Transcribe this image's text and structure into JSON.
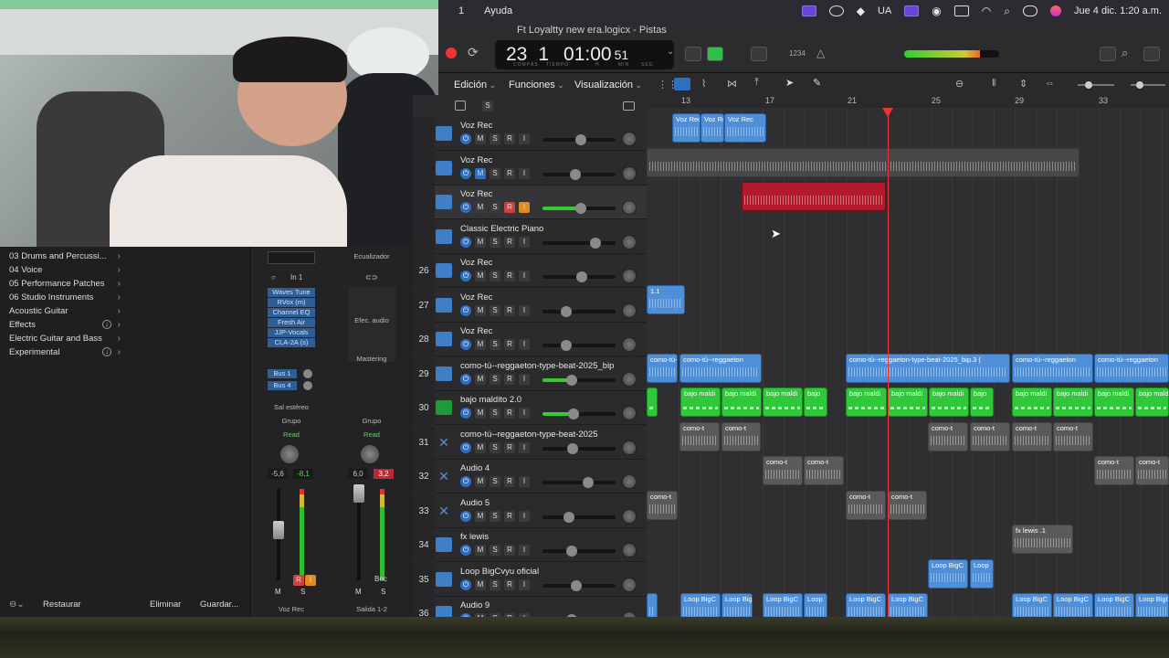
{
  "menubar": {
    "items": [
      "1",
      "Ayuda"
    ],
    "keyboard": "UA",
    "datetime": "Jue 4 dic.  1:20 a.m."
  },
  "control": {
    "window_title": "Ft Loyaltty new era.logicx - Pistas",
    "bar": "23",
    "beat": "1",
    "time_main": "01:00",
    "time_frac": "51",
    "lcd_labels": [
      "COMPÁS",
      "TIEMPO",
      "H",
      "MIN",
      "SEG"
    ],
    "tempo_icon": "1234"
  },
  "trackbar": {
    "edit": "Edición",
    "functions": "Funciones",
    "view": "Visualización"
  },
  "ruler": [
    "13",
    "17",
    "21",
    "25",
    "29",
    "33"
  ],
  "library": {
    "items": [
      {
        "label": "03 Drums and Percussi...",
        "kind": "chev"
      },
      {
        "label": "04 Voice",
        "kind": "chev"
      },
      {
        "label": "05 Performance Patches",
        "kind": "chev"
      },
      {
        "label": "06 Studio Instruments",
        "kind": "chev"
      },
      {
        "label": "Acoustic Guitar",
        "kind": "chev"
      },
      {
        "label": "Effects",
        "kind": "dl"
      },
      {
        "label": "Electric Guitar and Bass",
        "kind": "chev"
      },
      {
        "label": "Experimental",
        "kind": "dl"
      }
    ],
    "restore": "Restaurar",
    "delete": "Eliminar",
    "save": "Guardar..."
  },
  "mixer": {
    "eq_label": "Ecualizador",
    "input": "In 1",
    "plugins": [
      "Waves Tune",
      "RVox (m)",
      "Channel EQ",
      "Fresh Air",
      "JJP-Vocals",
      "CLA-2A (s)"
    ],
    "sends": [
      "Bus 1",
      "Bus 4"
    ],
    "fx_label": "Efec. audio",
    "mastering": "Mastering",
    "output": "Sal estéreo",
    "group": "Grupo",
    "automation": "Read",
    "s1_vol": "-5,6",
    "s1_peak": "-8,1",
    "s2_vol": "6,0",
    "s2_peak": "3,2",
    "s2_bnc": "Bnc",
    "s1_name": "Voz Rec",
    "s2_name": "Salida 1-2"
  },
  "tracks": [
    {
      "num": "",
      "name": "Voz Rec",
      "icon": "audio"
    },
    {
      "num": "",
      "name": "Voz Rec",
      "icon": "audio"
    },
    {
      "num": "",
      "name": "Voz Rec",
      "icon": "audio",
      "armed": true
    },
    {
      "num": "",
      "name": "Classic Electric Piano",
      "icon": "audio"
    },
    {
      "num": "26",
      "name": "Voz Rec",
      "icon": "audio"
    },
    {
      "num": "27",
      "name": "Voz Rec",
      "icon": "audio"
    },
    {
      "num": "28",
      "name": "Voz Rec",
      "icon": "audio"
    },
    {
      "num": "29",
      "name": "como-tú--reggaeton-type-beat-2025_bip",
      "icon": "audio"
    },
    {
      "num": "30",
      "name": "bajo maldito 2.0",
      "icon": "synth"
    },
    {
      "num": "31",
      "name": "como-tú--reggaeton-type-beat-2025",
      "icon": "x"
    },
    {
      "num": "32",
      "name": "Audio 4",
      "icon": "x"
    },
    {
      "num": "33",
      "name": "Audio 5",
      "icon": "x"
    },
    {
      "num": "34",
      "name": "fx lewis",
      "icon": "audio"
    },
    {
      "num": "35",
      "name": "Loop BigCvyu oficial",
      "icon": "audio"
    },
    {
      "num": "36",
      "name": "Audio 9",
      "icon": "audio"
    }
  ],
  "region_labels": {
    "voz": "Voz Rec",
    "beat_bip": "como-tú--reggaeton",
    "beat_bip3": "como-tú--reggaeton-type-beat-2025_bip.3 (",
    "bajo": "bajo maldi",
    "bajo_short": "bajo",
    "como": "como-t",
    "fx": "fx lewis .1",
    "loop": "Loop BigC",
    "loop_short": "Loop",
    "r1": "1.1"
  }
}
